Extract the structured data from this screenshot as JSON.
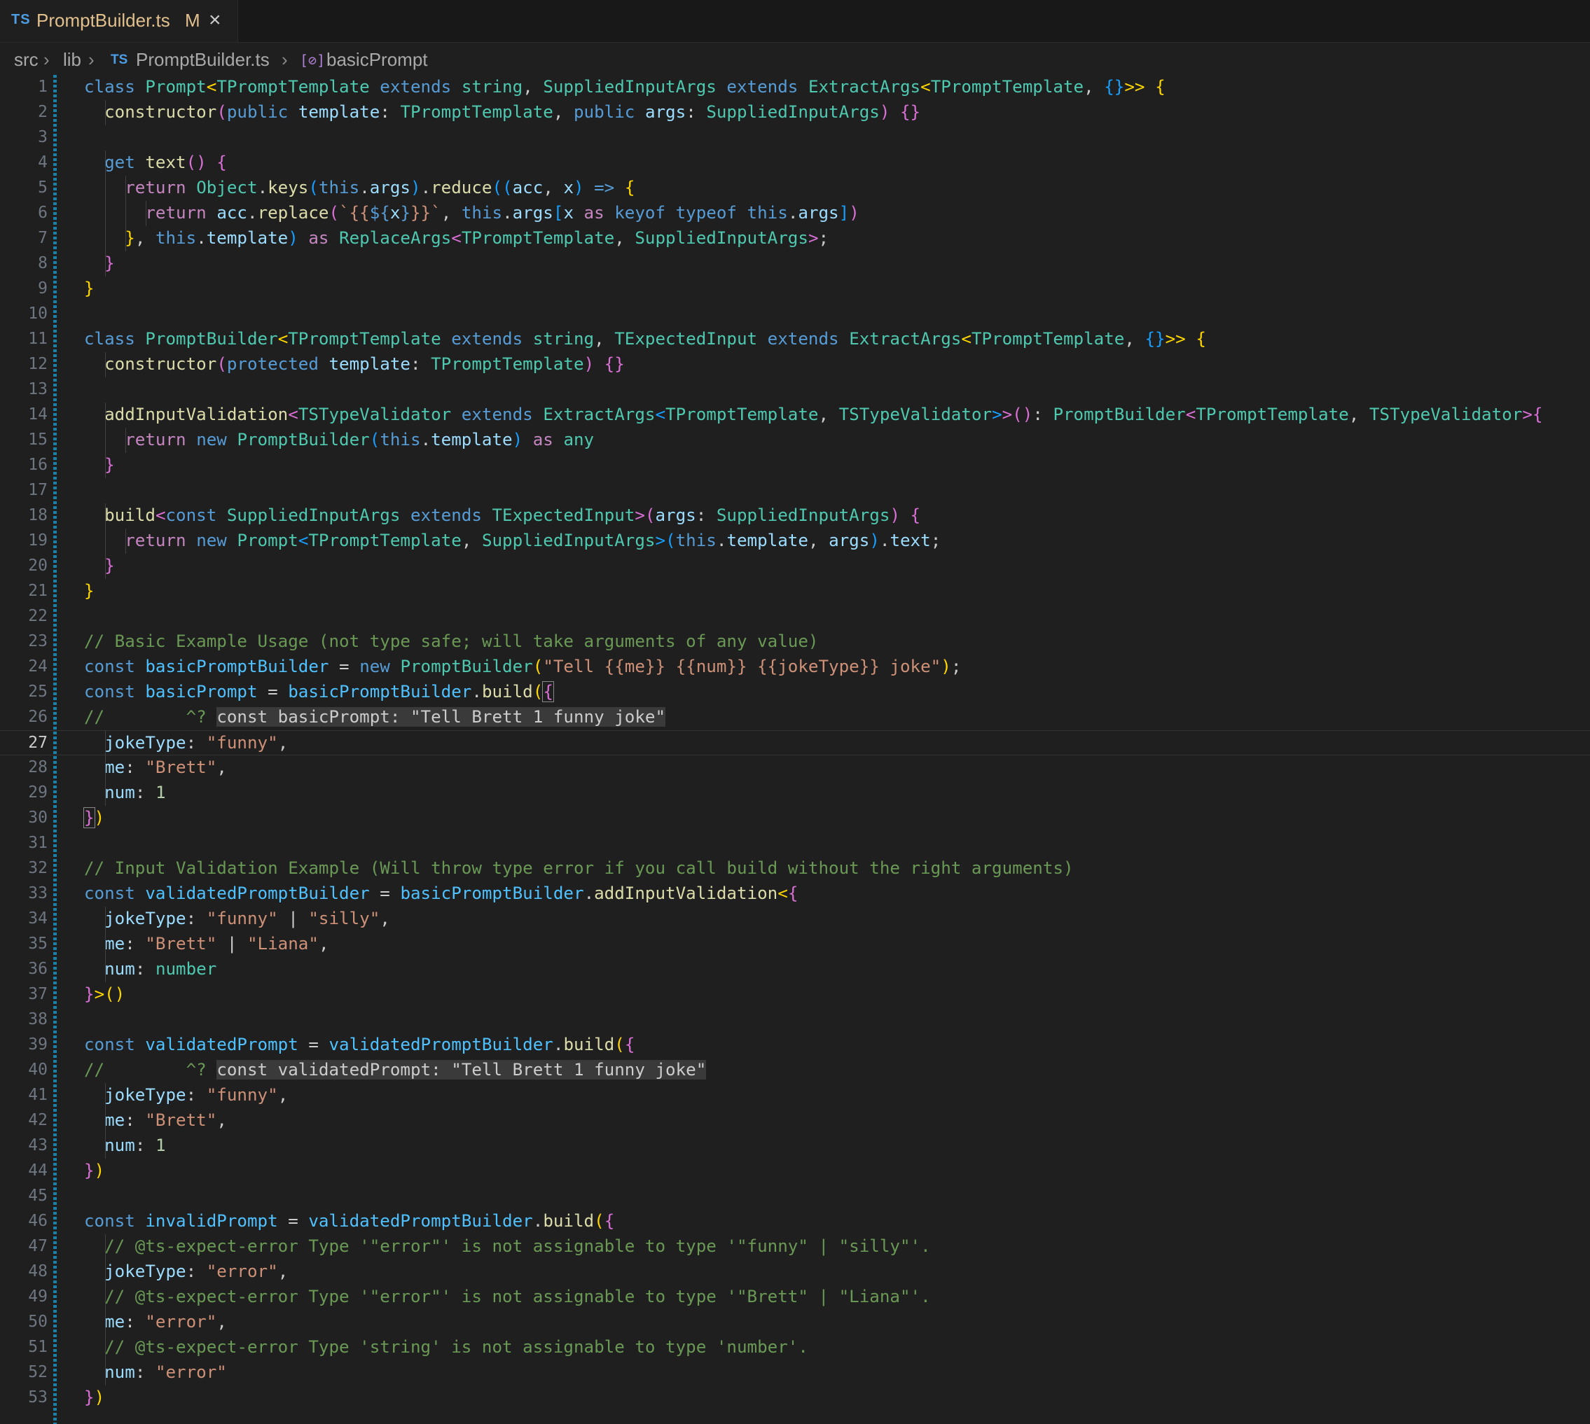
{
  "tab": {
    "lang_badge": "TS",
    "file_name": "PromptBuilder.ts",
    "modified": "M",
    "close_icon": "×"
  },
  "breadcrumb": {
    "parts": [
      "src",
      "lib",
      "PromptBuilder.ts",
      "basicPrompt"
    ],
    "file_badge": "TS",
    "symbol_icon": "[⊘]"
  },
  "editor": {
    "active_line": 27,
    "lines": [
      [
        [
          "t-kw",
          "class "
        ],
        [
          "t-ty",
          "Prompt"
        ],
        [
          "t-p1",
          "<"
        ],
        [
          "t-ty",
          "TPromptTemplate"
        ],
        [
          "t-kw",
          " extends "
        ],
        [
          "t-ty",
          "string"
        ],
        [
          "t-txt",
          ", "
        ],
        [
          "t-ty",
          "SuppliedInputArgs"
        ],
        [
          "t-kw",
          " extends "
        ],
        [
          "t-ty",
          "ExtractArgs"
        ],
        [
          "t-p1",
          "<"
        ],
        [
          "t-ty",
          "TPromptTemplate"
        ],
        [
          "t-txt",
          ", "
        ],
        [
          "t-p3",
          "{}"
        ],
        [
          "t-p1",
          ">>"
        ],
        [
          "t-txt",
          " "
        ],
        [
          "t-p1",
          "{"
        ]
      ],
      [
        [
          "t-txt",
          "  "
        ],
        [
          "t-fn",
          "constructor"
        ],
        [
          "t-p2",
          "("
        ],
        [
          "t-kw",
          "public "
        ],
        [
          "t-var",
          "template"
        ],
        [
          "t-txt",
          ": "
        ],
        [
          "t-ty",
          "TPromptTemplate"
        ],
        [
          "t-txt",
          ", "
        ],
        [
          "t-kw",
          "public "
        ],
        [
          "t-var",
          "args"
        ],
        [
          "t-txt",
          ": "
        ],
        [
          "t-ty",
          "SuppliedInputArgs"
        ],
        [
          "t-p2",
          ") {}"
        ]
      ],
      [],
      [
        [
          "t-txt",
          "  "
        ],
        [
          "t-kw",
          "get "
        ],
        [
          "t-fn",
          "text"
        ],
        [
          "t-p2",
          "() {"
        ]
      ],
      [
        [
          "t-txt",
          "    "
        ],
        [
          "t-ctl",
          "return "
        ],
        [
          "t-ty",
          "Object"
        ],
        [
          "t-txt",
          "."
        ],
        [
          "t-fn",
          "keys"
        ],
        [
          "t-p3",
          "("
        ],
        [
          "t-kw",
          "this"
        ],
        [
          "t-txt",
          "."
        ],
        [
          "t-var",
          "args"
        ],
        [
          "t-p3",
          ")"
        ],
        [
          "t-txt",
          "."
        ],
        [
          "t-fn",
          "reduce"
        ],
        [
          "t-p3",
          "(("
        ],
        [
          "t-var",
          "acc"
        ],
        [
          "t-txt",
          ", "
        ],
        [
          "t-var",
          "x"
        ],
        [
          "t-p3",
          ")"
        ],
        [
          "t-kw",
          " => "
        ],
        [
          "t-p1",
          "{"
        ]
      ],
      [
        [
          "t-txt",
          "      "
        ],
        [
          "t-ctl",
          "return "
        ],
        [
          "t-var",
          "acc"
        ],
        [
          "t-txt",
          "."
        ],
        [
          "t-fn",
          "replace"
        ],
        [
          "t-p2",
          "("
        ],
        [
          "t-str",
          "`{{"
        ],
        [
          "t-kw",
          "${"
        ],
        [
          "t-var",
          "x"
        ],
        [
          "t-kw",
          "}"
        ],
        [
          "t-str",
          "}}`"
        ],
        [
          "t-txt",
          ", "
        ],
        [
          "t-kw",
          "this"
        ],
        [
          "t-txt",
          "."
        ],
        [
          "t-var",
          "args"
        ],
        [
          "t-p3",
          "["
        ],
        [
          "t-var",
          "x"
        ],
        [
          "t-ctl",
          " as "
        ],
        [
          "t-kw",
          "keyof typeof this"
        ],
        [
          "t-txt",
          "."
        ],
        [
          "t-var",
          "args"
        ],
        [
          "t-p3",
          "]"
        ],
        [
          "t-p2",
          ")"
        ]
      ],
      [
        [
          "t-txt",
          "    "
        ],
        [
          "t-p1",
          "}"
        ],
        [
          "t-txt",
          ", "
        ],
        [
          "t-kw",
          "this"
        ],
        [
          "t-txt",
          "."
        ],
        [
          "t-var",
          "template"
        ],
        [
          "t-p3",
          ")"
        ],
        [
          "t-ctl",
          " as "
        ],
        [
          "t-ty",
          "ReplaceArgs"
        ],
        [
          "t-p2",
          "<"
        ],
        [
          "t-ty",
          "TPromptTemplate"
        ],
        [
          "t-txt",
          ", "
        ],
        [
          "t-ty",
          "SuppliedInputArgs"
        ],
        [
          "t-p2",
          ">"
        ],
        [
          "t-txt",
          ";"
        ]
      ],
      [
        [
          "t-txt",
          "  "
        ],
        [
          "t-p2",
          "}"
        ]
      ],
      [
        [
          "t-p1",
          "}"
        ]
      ],
      [],
      [
        [
          "t-kw",
          "class "
        ],
        [
          "t-ty",
          "PromptBuilder"
        ],
        [
          "t-p1",
          "<"
        ],
        [
          "t-ty",
          "TPromptTemplate"
        ],
        [
          "t-kw",
          " extends "
        ],
        [
          "t-ty",
          "string"
        ],
        [
          "t-txt",
          ", "
        ],
        [
          "t-ty",
          "TExpectedInput"
        ],
        [
          "t-kw",
          " extends "
        ],
        [
          "t-ty",
          "ExtractArgs"
        ],
        [
          "t-p1",
          "<"
        ],
        [
          "t-ty",
          "TPromptTemplate"
        ],
        [
          "t-txt",
          ", "
        ],
        [
          "t-p3",
          "{}"
        ],
        [
          "t-p1",
          ">>"
        ],
        [
          "t-txt",
          " "
        ],
        [
          "t-p1",
          "{"
        ]
      ],
      [
        [
          "t-txt",
          "  "
        ],
        [
          "t-fn",
          "constructor"
        ],
        [
          "t-p2",
          "("
        ],
        [
          "t-kw",
          "protected "
        ],
        [
          "t-var",
          "template"
        ],
        [
          "t-txt",
          ": "
        ],
        [
          "t-ty",
          "TPromptTemplate"
        ],
        [
          "t-p2",
          ") {}"
        ]
      ],
      [],
      [
        [
          "t-txt",
          "  "
        ],
        [
          "t-fn",
          "addInputValidation"
        ],
        [
          "t-p2",
          "<"
        ],
        [
          "t-ty",
          "TSTypeValidator"
        ],
        [
          "t-kw",
          " extends "
        ],
        [
          "t-ty",
          "ExtractArgs"
        ],
        [
          "t-p3",
          "<"
        ],
        [
          "t-ty",
          "TPromptTemplate"
        ],
        [
          "t-txt",
          ", "
        ],
        [
          "t-ty",
          "TSTypeValidator"
        ],
        [
          "t-p3",
          ">"
        ],
        [
          "t-p2",
          ">()"
        ],
        [
          "t-txt",
          ": "
        ],
        [
          "t-ty",
          "PromptBuilder"
        ],
        [
          "t-p2",
          "<"
        ],
        [
          "t-ty",
          "TPromptTemplate"
        ],
        [
          "t-txt",
          ", "
        ],
        [
          "t-ty",
          "TSTypeValidator"
        ],
        [
          "t-p2",
          ">{"
        ]
      ],
      [
        [
          "t-txt",
          "    "
        ],
        [
          "t-ctl",
          "return "
        ],
        [
          "t-kw",
          "new "
        ],
        [
          "t-ty",
          "PromptBuilder"
        ],
        [
          "t-p3",
          "("
        ],
        [
          "t-kw",
          "this"
        ],
        [
          "t-txt",
          "."
        ],
        [
          "t-var",
          "template"
        ],
        [
          "t-p3",
          ")"
        ],
        [
          "t-ctl",
          " as "
        ],
        [
          "t-ty",
          "any"
        ]
      ],
      [
        [
          "t-txt",
          "  "
        ],
        [
          "t-p2",
          "}"
        ]
      ],
      [],
      [
        [
          "t-txt",
          "  "
        ],
        [
          "t-fn",
          "build"
        ],
        [
          "t-p2",
          "<"
        ],
        [
          "t-kw",
          "const "
        ],
        [
          "t-ty",
          "SuppliedInputArgs"
        ],
        [
          "t-kw",
          " extends "
        ],
        [
          "t-ty",
          "TExpectedInput"
        ],
        [
          "t-p2",
          ">("
        ],
        [
          "t-var",
          "args"
        ],
        [
          "t-txt",
          ": "
        ],
        [
          "t-ty",
          "SuppliedInputArgs"
        ],
        [
          "t-p2",
          ") {"
        ]
      ],
      [
        [
          "t-txt",
          "    "
        ],
        [
          "t-ctl",
          "return "
        ],
        [
          "t-kw",
          "new "
        ],
        [
          "t-ty",
          "Prompt"
        ],
        [
          "t-p3",
          "<"
        ],
        [
          "t-ty",
          "TPromptTemplate"
        ],
        [
          "t-txt",
          ", "
        ],
        [
          "t-ty",
          "SuppliedInputArgs"
        ],
        [
          "t-p3",
          ">("
        ],
        [
          "t-kw",
          "this"
        ],
        [
          "t-txt",
          "."
        ],
        [
          "t-var",
          "template"
        ],
        [
          "t-txt",
          ", "
        ],
        [
          "t-var",
          "args"
        ],
        [
          "t-p3",
          ")"
        ],
        [
          "t-txt",
          "."
        ],
        [
          "t-var",
          "text"
        ],
        [
          "t-txt",
          ";"
        ]
      ],
      [
        [
          "t-txt",
          "  "
        ],
        [
          "t-p2",
          "}"
        ]
      ],
      [
        [
          "t-p1",
          "}"
        ]
      ],
      [],
      [
        [
          "t-com",
          "// Basic Example Usage (not type safe; will take arguments of any value)"
        ]
      ],
      [
        [
          "t-kw",
          "const "
        ],
        [
          "t-cst",
          "basicPromptBuilder"
        ],
        [
          "t-txt",
          " = "
        ],
        [
          "t-kw",
          "new "
        ],
        [
          "t-ty",
          "PromptBuilder"
        ],
        [
          "t-p1",
          "("
        ],
        [
          "t-str",
          "\"Tell {{me}} {{num}} {{jokeType}} joke\""
        ],
        [
          "t-p1",
          ")"
        ],
        [
          "t-txt",
          ";"
        ]
      ],
      [
        [
          "t-kw",
          "const "
        ],
        [
          "t-cst",
          "basicPrompt"
        ],
        [
          "t-txt",
          " = "
        ],
        [
          "t-cst",
          "basicPromptBuilder"
        ],
        [
          "t-txt",
          "."
        ],
        [
          "t-fn",
          "build"
        ],
        [
          "t-p1",
          "("
        ],
        [
          "t-p2 t-hl",
          "{"
        ]
      ],
      [
        [
          "t-com",
          "//        ^? "
        ],
        [
          "t-hint",
          "const basicPrompt: \"Tell Brett 1 funny joke\""
        ]
      ],
      [
        [
          "t-txt",
          "  "
        ],
        [
          "t-var",
          "jokeType"
        ],
        [
          "t-txt",
          ": "
        ],
        [
          "t-str",
          "\"funny\""
        ],
        [
          "t-txt",
          ","
        ]
      ],
      [
        [
          "t-txt",
          "  "
        ],
        [
          "t-var",
          "me"
        ],
        [
          "t-txt",
          ": "
        ],
        [
          "t-str",
          "\"Brett\""
        ],
        [
          "t-txt",
          ","
        ]
      ],
      [
        [
          "t-txt",
          "  "
        ],
        [
          "t-var",
          "num"
        ],
        [
          "t-txt",
          ": "
        ],
        [
          "t-num",
          "1"
        ]
      ],
      [
        [
          "t-p2 t-hl",
          "}"
        ],
        [
          "t-p1",
          ")"
        ]
      ],
      [],
      [
        [
          "t-com",
          "// Input Validation Example (Will throw type error if you call build without the right arguments)"
        ]
      ],
      [
        [
          "t-kw",
          "const "
        ],
        [
          "t-cst",
          "validatedPromptBuilder"
        ],
        [
          "t-txt",
          " = "
        ],
        [
          "t-cst",
          "basicPromptBuilder"
        ],
        [
          "t-txt",
          "."
        ],
        [
          "t-fn",
          "addInputValidation"
        ],
        [
          "t-p1",
          "<"
        ],
        [
          "t-p2",
          "{"
        ]
      ],
      [
        [
          "t-txt",
          "  "
        ],
        [
          "t-var",
          "jokeType"
        ],
        [
          "t-txt",
          ": "
        ],
        [
          "t-str",
          "\"funny\""
        ],
        [
          "t-txt",
          " | "
        ],
        [
          "t-str",
          "\"silly\""
        ],
        [
          "t-txt",
          ","
        ]
      ],
      [
        [
          "t-txt",
          "  "
        ],
        [
          "t-var",
          "me"
        ],
        [
          "t-txt",
          ": "
        ],
        [
          "t-str",
          "\"Brett\""
        ],
        [
          "t-txt",
          " | "
        ],
        [
          "t-str",
          "\"Liana\""
        ],
        [
          "t-txt",
          ","
        ]
      ],
      [
        [
          "t-txt",
          "  "
        ],
        [
          "t-var",
          "num"
        ],
        [
          "t-txt",
          ": "
        ],
        [
          "t-ty",
          "number"
        ]
      ],
      [
        [
          "t-p2",
          "}"
        ],
        [
          "t-p1",
          ">()"
        ]
      ],
      [],
      [
        [
          "t-kw",
          "const "
        ],
        [
          "t-cst",
          "validatedPrompt"
        ],
        [
          "t-txt",
          " = "
        ],
        [
          "t-cst",
          "validatedPromptBuilder"
        ],
        [
          "t-txt",
          "."
        ],
        [
          "t-fn",
          "build"
        ],
        [
          "t-p1",
          "("
        ],
        [
          "t-p2",
          "{"
        ]
      ],
      [
        [
          "t-com",
          "//        ^? "
        ],
        [
          "t-hint",
          "const validatedPrompt: \"Tell Brett 1 funny joke\""
        ]
      ],
      [
        [
          "t-txt",
          "  "
        ],
        [
          "t-var",
          "jokeType"
        ],
        [
          "t-txt",
          ": "
        ],
        [
          "t-str",
          "\"funny\""
        ],
        [
          "t-txt",
          ","
        ]
      ],
      [
        [
          "t-txt",
          "  "
        ],
        [
          "t-var",
          "me"
        ],
        [
          "t-txt",
          ": "
        ],
        [
          "t-str",
          "\"Brett\""
        ],
        [
          "t-txt",
          ","
        ]
      ],
      [
        [
          "t-txt",
          "  "
        ],
        [
          "t-var",
          "num"
        ],
        [
          "t-txt",
          ": "
        ],
        [
          "t-num",
          "1"
        ]
      ],
      [
        [
          "t-p2",
          "}"
        ],
        [
          "t-p1",
          ")"
        ]
      ],
      [],
      [
        [
          "t-kw",
          "const "
        ],
        [
          "t-cst",
          "invalidPrompt"
        ],
        [
          "t-txt",
          " = "
        ],
        [
          "t-cst",
          "validatedPromptBuilder"
        ],
        [
          "t-txt",
          "."
        ],
        [
          "t-fn",
          "build"
        ],
        [
          "t-p1",
          "("
        ],
        [
          "t-p2",
          "{"
        ]
      ],
      [
        [
          "t-txt",
          "  "
        ],
        [
          "t-com",
          "// @ts-expect-error Type '\"error\"' is not assignable to type '\"funny\" | \"silly\"'."
        ]
      ],
      [
        [
          "t-txt",
          "  "
        ],
        [
          "t-var",
          "jokeType"
        ],
        [
          "t-txt",
          ": "
        ],
        [
          "t-str",
          "\"error\""
        ],
        [
          "t-txt",
          ","
        ]
      ],
      [
        [
          "t-txt",
          "  "
        ],
        [
          "t-com",
          "// @ts-expect-error Type '\"error\"' is not assignable to type '\"Brett\" | \"Liana\"'."
        ]
      ],
      [
        [
          "t-txt",
          "  "
        ],
        [
          "t-var",
          "me"
        ],
        [
          "t-txt",
          ": "
        ],
        [
          "t-str",
          "\"error\""
        ],
        [
          "t-txt",
          ","
        ]
      ],
      [
        [
          "t-txt",
          "  "
        ],
        [
          "t-com",
          "// @ts-expect-error Type 'string' is not assignable to type 'number'."
        ]
      ],
      [
        [
          "t-txt",
          "  "
        ],
        [
          "t-var",
          "num"
        ],
        [
          "t-txt",
          ": "
        ],
        [
          "t-str",
          "\"error\""
        ]
      ],
      [
        [
          "t-p2",
          "}"
        ],
        [
          "t-p1",
          ")"
        ]
      ]
    ]
  }
}
